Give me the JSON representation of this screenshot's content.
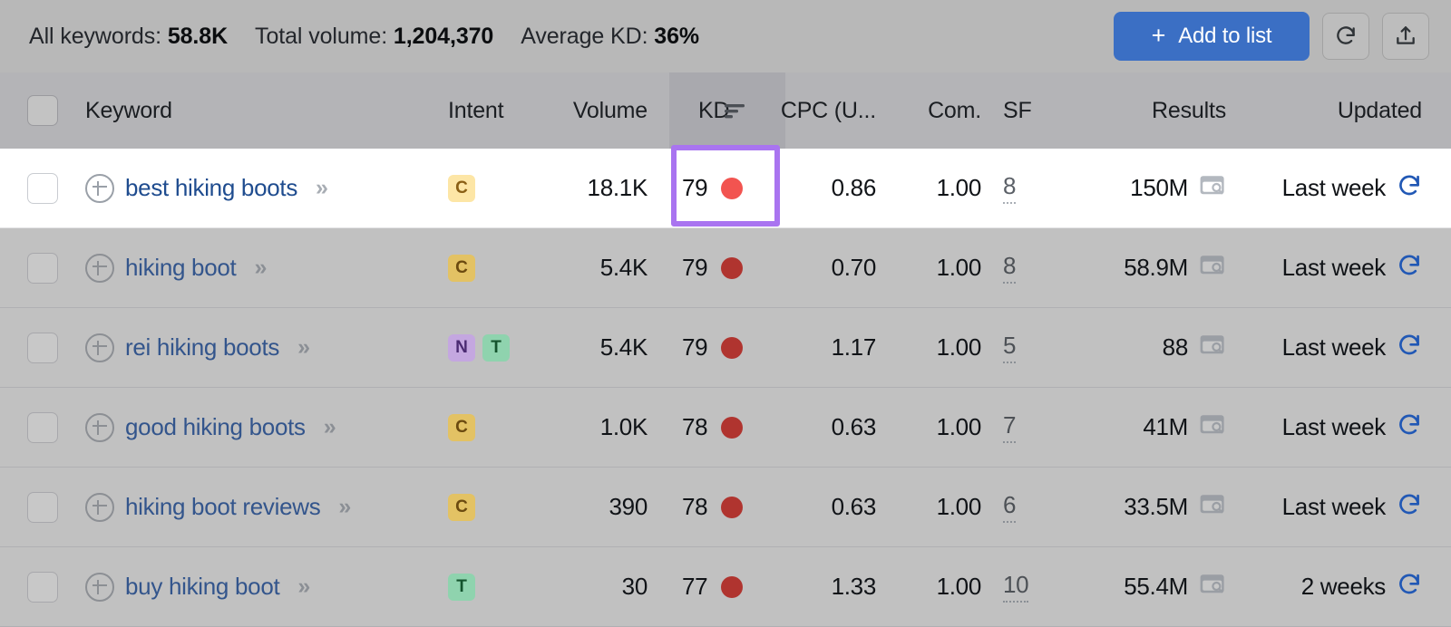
{
  "summary": {
    "stats": [
      {
        "label": "All keywords:",
        "value": "58.8K"
      },
      {
        "label": "Total volume:",
        "value": "1,204,370"
      },
      {
        "label": "Average KD:",
        "value": "36%"
      }
    ],
    "add_to_list_label": "Add to list",
    "add_to_list_plus": "+",
    "refresh_button_icon": "refresh-icon",
    "export_button_icon": "upload-icon"
  },
  "table": {
    "columns": {
      "select_all": "",
      "keyword": "Keyword",
      "intent": "Intent",
      "volume": "Volume",
      "kd": "KD",
      "kd_sort_icon": "sort-descending-icon",
      "cpc": "CPC (U...",
      "com": "Com.",
      "sf": "SF",
      "results": "Results",
      "updated": "Updated"
    },
    "rows": [
      {
        "keyword": "best hiking boots",
        "expand": "»",
        "intents": [
          "C"
        ],
        "volume": "18.1K",
        "kd": "79",
        "kd_color": "#f25450",
        "cpc": "0.86",
        "com": "1.00",
        "sf": "8",
        "results": "150M",
        "updated": "Last week",
        "highlighted": true
      },
      {
        "keyword": "hiking boot",
        "expand": "»",
        "intents": [
          "C"
        ],
        "volume": "5.4K",
        "kd": "79",
        "kd_color": "#b0342f",
        "cpc": "0.70",
        "com": "1.00",
        "sf": "8",
        "results": "58.9M",
        "updated": "Last week",
        "highlighted": false
      },
      {
        "keyword": "rei hiking boots",
        "expand": "»",
        "intents": [
          "N",
          "T"
        ],
        "volume": "5.4K",
        "kd": "79",
        "kd_color": "#b0342f",
        "cpc": "1.17",
        "com": "1.00",
        "sf": "5",
        "results": "88",
        "updated": "Last week",
        "highlighted": false
      },
      {
        "keyword": "good hiking boots",
        "expand": "»",
        "intents": [
          "C"
        ],
        "volume": "1.0K",
        "kd": "78",
        "kd_color": "#b0342f",
        "cpc": "0.63",
        "com": "1.00",
        "sf": "7",
        "results": "41M",
        "updated": "Last week",
        "highlighted": false
      },
      {
        "keyword": "hiking boot reviews",
        "expand": "»",
        "intents": [
          "C"
        ],
        "volume": "390",
        "kd": "78",
        "kd_color": "#b0342f",
        "cpc": "0.63",
        "com": "1.00",
        "sf": "6",
        "results": "33.5M",
        "updated": "Last week",
        "highlighted": false
      },
      {
        "keyword": "buy hiking boot",
        "expand": "»",
        "intents": [
          "T"
        ],
        "volume": "30",
        "kd": "77",
        "kd_color": "#b0342f",
        "cpc": "1.33",
        "com": "1.00",
        "sf": "10",
        "results": "55.4M",
        "updated": "2 weeks",
        "highlighted": false
      }
    ]
  },
  "annotation": {
    "kd_highlight_color": "#a974f0",
    "target": "kd-cell-row-1"
  }
}
